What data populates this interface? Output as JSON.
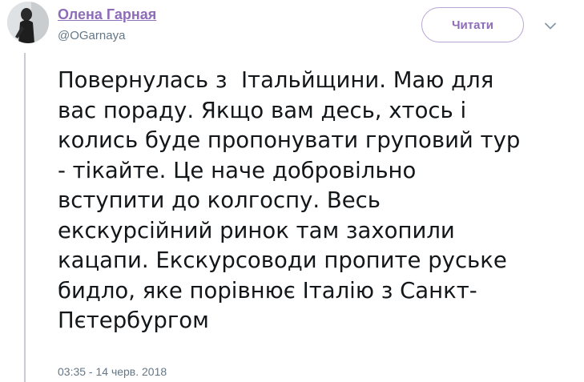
{
  "tweet": {
    "author": {
      "display_name": "Олена Гарная",
      "handle": "@OGarnaya"
    },
    "follow_label": "Читати",
    "menu_icon": "chevron-down-icon",
    "lines": [
      "Повернулась з  Італьйщини. Маю для",
      "вас пораду. Якщо вам десь, хтось і",
      "колись буде пропонувати груповий тур",
      "- тікайте. Це наче добровільно",
      "вступити до колгоспу. Весь",
      "екскурсійний ринок там захопили",
      "кацапи. Екскурсоводи пропите руське",
      "бидло, яке порівнює Італію з Санкт-",
      "Пєтербургом"
    ],
    "timestamp": "03:35 - 14 черв. 2018"
  },
  "colors": {
    "name_accent": "#8e6db8",
    "follow_border": "#b8a5d6",
    "secondary_text": "#657786",
    "body_text": "#14171a"
  }
}
